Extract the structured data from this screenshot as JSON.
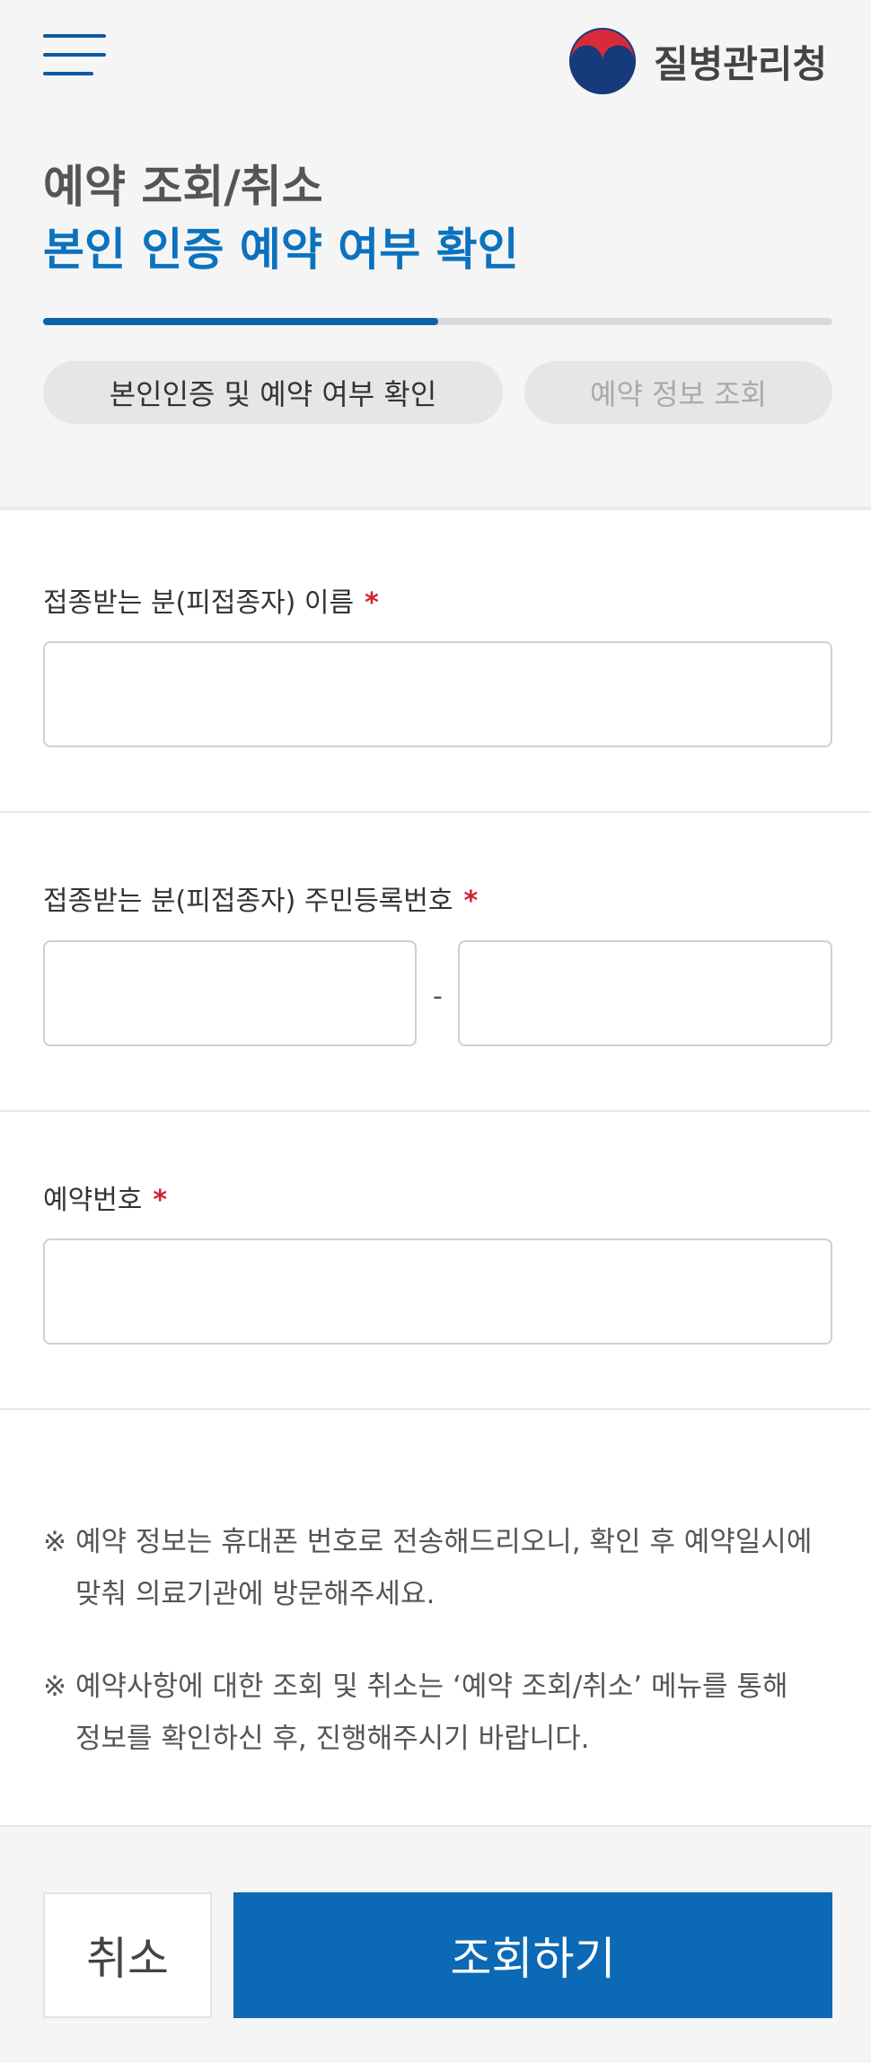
{
  "header": {
    "menu_icon": "hamburger-menu-icon",
    "logo_icon": "korea-taegeuk-emblem-icon",
    "logo_text": "질병관리청"
  },
  "page": {
    "title": "예약 조회/취소",
    "subtitle": "본인 인증 예약 여부 확인",
    "progress": 0.5
  },
  "steps": [
    {
      "label": "본인인증 및 예약 여부 확인",
      "active": true
    },
    {
      "label": "예약 정보 조회",
      "active": false
    }
  ],
  "form": {
    "required_mark": "*",
    "name_label": "접종받는 분(피접종자) 이름",
    "rrn_label": "접종받는 분(피접종자) 주민등록번호",
    "rrn_separator": "-",
    "reservation_label": "예약번호"
  },
  "notices": [
    {
      "mark": "※",
      "line1": "예약 정보는 휴대폰 번호로 전송해드리오니, 확인 후 예약일시에",
      "line2": "맞춰 의료기관에 방문해주세요."
    },
    {
      "mark": "※",
      "line1": "예약사항에 대한 조회 및 취소는 ‘예약 조회/취소’ 메뉴를 통해",
      "line2": "정보를 확인하신 후, 진행해주시기 바랍니다."
    }
  ],
  "actions": {
    "cancel_label": "취소",
    "submit_label": "조회하기"
  },
  "colors": {
    "primary": "#0b69b5",
    "title_blue": "#0b72be",
    "required": "#d0222f"
  }
}
